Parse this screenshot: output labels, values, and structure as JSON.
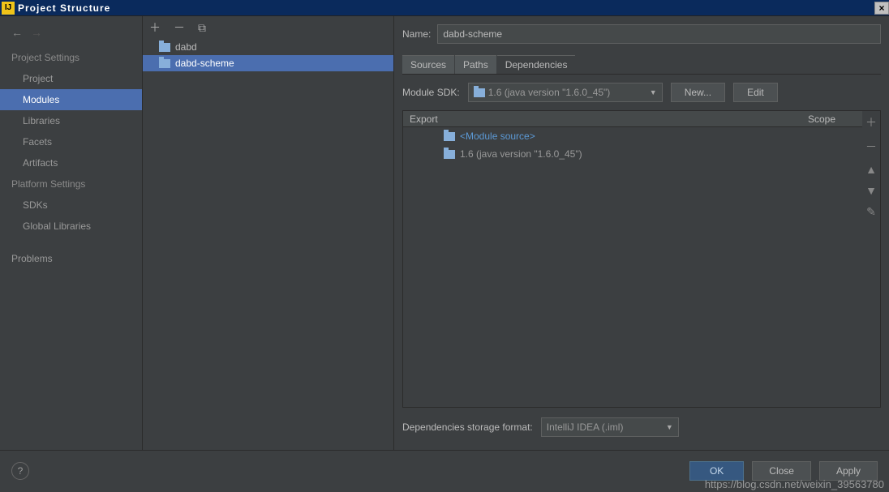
{
  "window": {
    "title": "Project Structure"
  },
  "sidebar": {
    "section1_label": "Project Settings",
    "items1": [
      {
        "label": "Project"
      },
      {
        "label": "Modules"
      },
      {
        "label": "Libraries"
      },
      {
        "label": "Facets"
      },
      {
        "label": "Artifacts"
      }
    ],
    "section2_label": "Platform Settings",
    "items2": [
      {
        "label": "SDKs"
      },
      {
        "label": "Global Libraries"
      }
    ],
    "problems_label": "Problems"
  },
  "modules": {
    "items": [
      {
        "label": "dabd"
      },
      {
        "label": "dabd-scheme"
      }
    ]
  },
  "main": {
    "name_label": "Name:",
    "name_value": "dabd-scheme",
    "tabs": [
      {
        "label": "Sources"
      },
      {
        "label": "Paths"
      },
      {
        "label": "Dependencies"
      }
    ],
    "sdk_label": "Module SDK:",
    "sdk_value": "1.6 (java version \"1.6.0_45\")",
    "new_btn": "New...",
    "edit_btn": "Edit",
    "table": {
      "col_export": "Export",
      "col_scope": "Scope",
      "rows": [
        {
          "label": "<Module source>",
          "type": "src"
        },
        {
          "label": "1.6 (java version \"1.6.0_45\")",
          "type": "lib"
        }
      ]
    },
    "storage_label": "Dependencies storage format:",
    "storage_value": "IntelliJ IDEA (.iml)"
  },
  "footer": {
    "ok": "OK",
    "cancel": "Close",
    "apply": "Apply"
  },
  "watermark": "https://blog.csdn.net/weixin_39563780"
}
